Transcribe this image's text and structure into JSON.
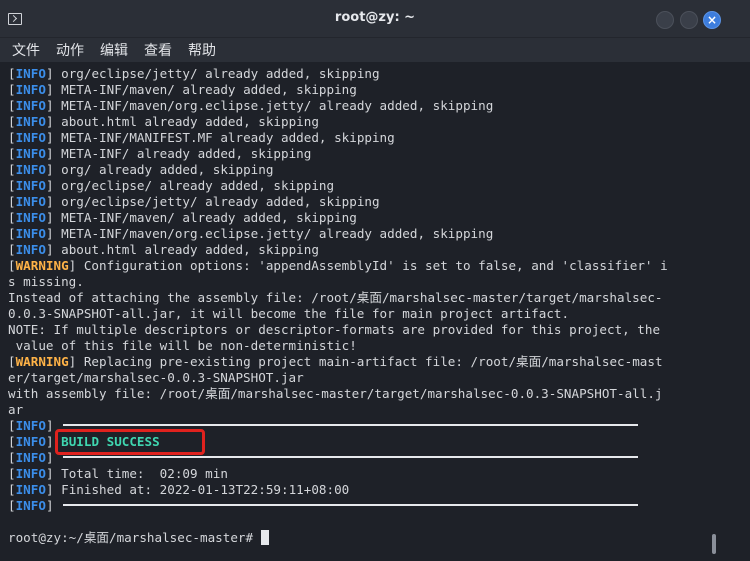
{
  "window": {
    "title": "root@zy: ~",
    "close_glyph": "×"
  },
  "menu": [
    "文件",
    "动作",
    "编辑",
    "查看",
    "帮助"
  ],
  "colors": {
    "info_tag": "#3b8eea",
    "warning_tag": "#ffb347",
    "success_text": "#3fd6b0",
    "highlight_border": "#e0221e"
  },
  "terminal": {
    "lines": [
      {
        "tag": "INFO",
        "text": " org/eclipse/jetty/ already added, skipping"
      },
      {
        "tag": "INFO",
        "text": " META-INF/maven/ already added, skipping"
      },
      {
        "tag": "INFO",
        "text": " META-INF/maven/org.eclipse.jetty/ already added, skipping"
      },
      {
        "tag": "INFO",
        "text": " about.html already added, skipping"
      },
      {
        "tag": "INFO",
        "text": " META-INF/MANIFEST.MF already added, skipping"
      },
      {
        "tag": "INFO",
        "text": " META-INF/ already added, skipping"
      },
      {
        "tag": "INFO",
        "text": " org/ already added, skipping"
      },
      {
        "tag": "INFO",
        "text": " org/eclipse/ already added, skipping"
      },
      {
        "tag": "INFO",
        "text": " org/eclipse/jetty/ already added, skipping"
      },
      {
        "tag": "INFO",
        "text": " META-INF/maven/ already added, skipping"
      },
      {
        "tag": "INFO",
        "text": " META-INF/maven/org.eclipse.jetty/ already added, skipping"
      },
      {
        "tag": "INFO",
        "text": " about.html already added, skipping"
      },
      {
        "tag": "WARNING",
        "text": " Configuration options: 'appendAssemblyId' is set to false, and 'classifier' i"
      },
      {
        "tag": "",
        "text": "s missing."
      },
      {
        "tag": "",
        "text": "Instead of attaching the assembly file: /root/桌面/marshalsec-master/target/marshalsec-"
      },
      {
        "tag": "",
        "text": "0.0.3-SNAPSHOT-all.jar, it will become the file for main project artifact."
      },
      {
        "tag": "",
        "text": "NOTE: If multiple descriptors or descriptor-formats are provided for this project, the"
      },
      {
        "tag": "",
        "text": " value of this file will be non-deterministic!"
      },
      {
        "tag": "WARNING",
        "text": " Replacing pre-existing project main-artifact file: /root/桌面/marshalsec-mast"
      },
      {
        "tag": "",
        "text": "er/target/marshalsec-0.0.3-SNAPSHOT.jar"
      },
      {
        "tag": "",
        "text": "with assembly file: /root/桌面/marshalsec-master/target/marshalsec-0.0.3-SNAPSHOT-all.j"
      },
      {
        "tag": "",
        "text": "ar"
      },
      {
        "tag": "INFO",
        "text": ""
      },
      {
        "tag": "INFO",
        "text": " BUILD SUCCESS",
        "success": true
      },
      {
        "tag": "INFO",
        "text": ""
      },
      {
        "tag": "INFO",
        "text": " Total time:  02:09 min"
      },
      {
        "tag": "INFO",
        "text": " Finished at: 2022-01-13T22:59:11+08:00"
      },
      {
        "tag": "INFO",
        "text": ""
      }
    ],
    "prompt": "root@zy:~/桌面/marshalsec-master# "
  }
}
